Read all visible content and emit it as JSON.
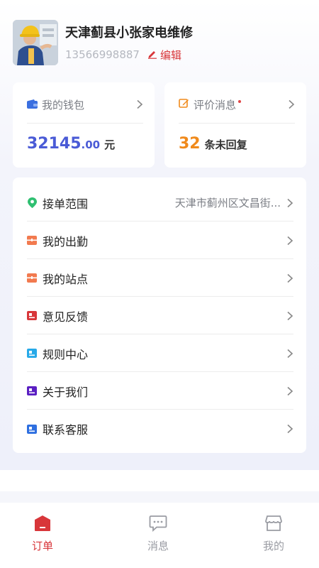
{
  "profile": {
    "name": "天津蓟县小张家电维修",
    "phone": "13566998887",
    "edit_label": "编辑"
  },
  "wallet": {
    "label": "我的钱包",
    "amount_int": "32145",
    "amount_dec": ".00",
    "unit": "元"
  },
  "review": {
    "label": "评价消息",
    "count": "32",
    "unit": "条未回复"
  },
  "menu": {
    "items": [
      {
        "label": "接单范围",
        "value": "天津市蓟州区文昌街...",
        "icon": "location-pin-icon",
        "color": "#2fbf71"
      },
      {
        "label": "我的出勤",
        "icon": "attendance-icon",
        "color": "#f27a4f"
      },
      {
        "label": "我的站点",
        "icon": "station-icon",
        "color": "#f27a4f"
      },
      {
        "label": "意见反馈",
        "icon": "feedback-icon",
        "color": "#d8363a"
      },
      {
        "label": "规则中心",
        "icon": "rules-icon",
        "color": "#27a9e8"
      },
      {
        "label": "关于我们",
        "icon": "about-icon",
        "color": "#5a1fc2"
      },
      {
        "label": "联系客服",
        "icon": "support-icon",
        "color": "#2e6fe0"
      }
    ]
  },
  "tabbar": {
    "orders": "订单",
    "messages": "消息",
    "mine": "我的"
  },
  "colors": {
    "accent_red": "#d8363a",
    "money_blue": "#4a5bd6",
    "count_orange": "#f08a1c"
  }
}
